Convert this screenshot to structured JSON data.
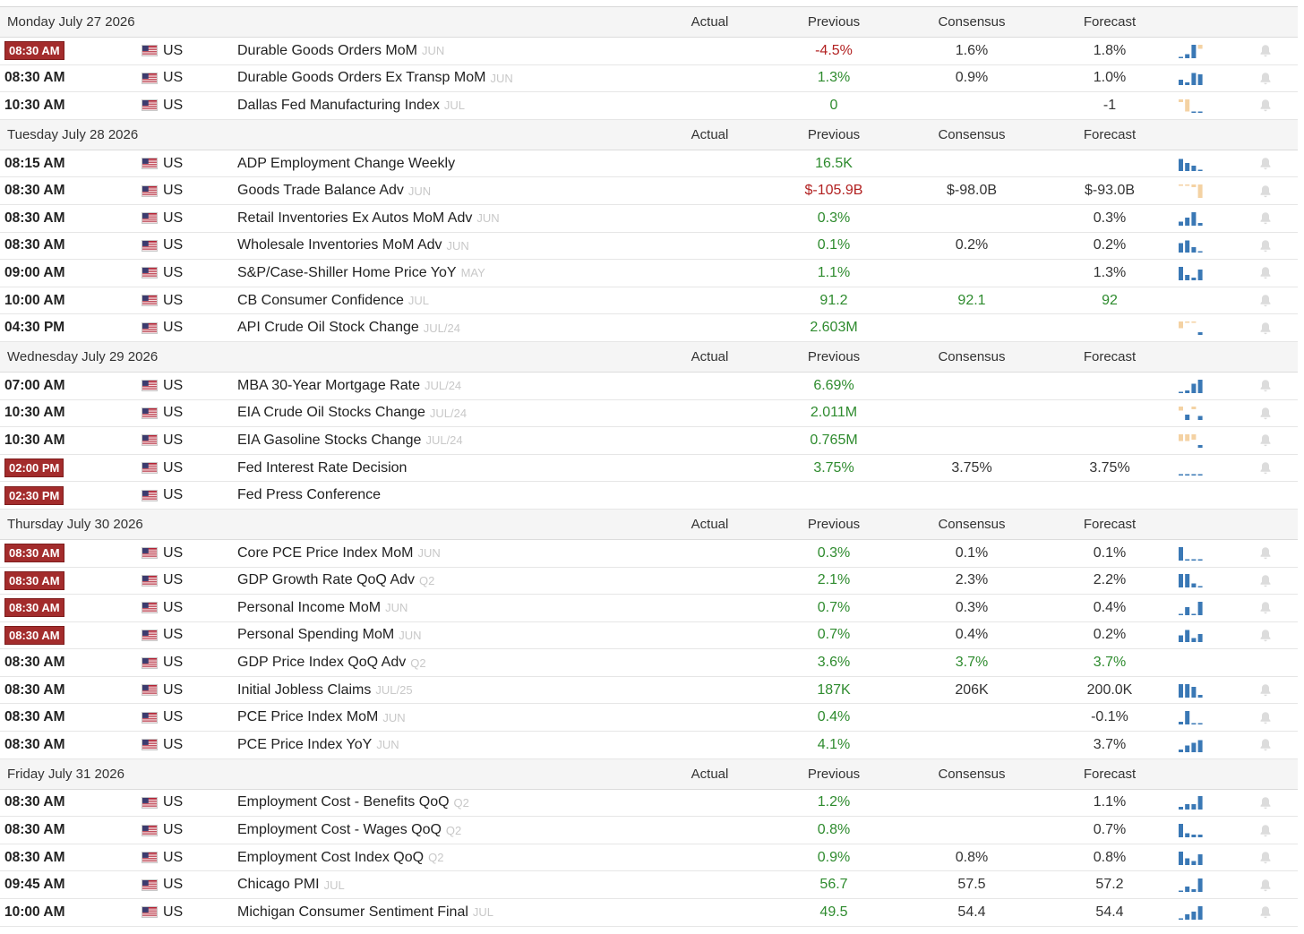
{
  "columns": {
    "actual": "Actual",
    "previous": "Previous",
    "consensus": "Consensus",
    "forecast": "Forecast"
  },
  "colors": {
    "badge": "#a32c2c",
    "negative": "#b22121",
    "positive": "#2e8b2e",
    "spark_up": "#3a78b5",
    "spark_down": "#f4d2a3"
  },
  "days": [
    {
      "date": "Monday July 27 2026",
      "events": [
        {
          "time": "08:30 AM",
          "highlight": true,
          "country": "US",
          "name": "Durable Goods Orders MoM",
          "period": "JUN",
          "actual": "",
          "previous": "-4.5%",
          "previous_color": "red",
          "consensus": "1.6%",
          "consensus_color": "neutral",
          "forecast": "1.8%",
          "forecast_color": "neutral",
          "spark": [
            1,
            3,
            10,
            -3
          ],
          "bell": true
        },
        {
          "time": "08:30 AM",
          "highlight": false,
          "country": "US",
          "name": "Durable Goods Orders Ex Transp MoM",
          "period": "JUN",
          "actual": "",
          "previous": "1.3%",
          "previous_color": "green",
          "consensus": "0.9%",
          "consensus_color": "neutral",
          "forecast": "1.0%",
          "forecast_color": "neutral",
          "spark": [
            4,
            2,
            9,
            8
          ],
          "bell": true
        },
        {
          "time": "10:30 AM",
          "highlight": false,
          "country": "US",
          "name": "Dallas Fed Manufacturing Index",
          "period": "JUL",
          "actual": "",
          "previous": "0",
          "previous_color": "green",
          "consensus": "",
          "consensus_color": "neutral",
          "forecast": "-1",
          "forecast_color": "neutral",
          "spark": [
            -2,
            -9,
            0,
            1
          ],
          "bell": true
        }
      ]
    },
    {
      "date": "Tuesday July 28 2026",
      "events": [
        {
          "time": "08:15 AM",
          "highlight": false,
          "country": "US",
          "name": "ADP Employment Change Weekly",
          "period": "",
          "actual": "",
          "previous": "16.5K",
          "previous_color": "green",
          "consensus": "",
          "consensus_color": "neutral",
          "forecast": "",
          "forecast_color": "neutral",
          "spark": [
            9,
            6,
            4,
            1
          ],
          "bell": true
        },
        {
          "time": "08:30 AM",
          "highlight": false,
          "country": "US",
          "name": "Goods Trade Balance Adv",
          "period": "JUN",
          "actual": "",
          "previous": "$-105.9B",
          "previous_color": "red",
          "consensus": "$-98.0B",
          "consensus_color": "neutral",
          "forecast": "$-93.0B",
          "forecast_color": "neutral",
          "spark": [
            -1,
            -1,
            -2,
            -10
          ],
          "bell": true
        },
        {
          "time": "08:30 AM",
          "highlight": false,
          "country": "US",
          "name": "Retail Inventories Ex Autos MoM Adv",
          "period": "JUN",
          "actual": "",
          "previous": "0.3%",
          "previous_color": "green",
          "consensus": "",
          "consensus_color": "neutral",
          "forecast": "0.3%",
          "forecast_color": "neutral",
          "spark": [
            3,
            6,
            10,
            2
          ],
          "bell": true
        },
        {
          "time": "08:30 AM",
          "highlight": false,
          "country": "US",
          "name": "Wholesale Inventories MoM Adv",
          "period": "JUN",
          "actual": "",
          "previous": "0.1%",
          "previous_color": "green",
          "consensus": "0.2%",
          "consensus_color": "neutral",
          "forecast": "0.2%",
          "forecast_color": "neutral",
          "spark": [
            7,
            9,
            4,
            1
          ],
          "bell": true
        },
        {
          "time": "09:00 AM",
          "highlight": false,
          "country": "US",
          "name": "S&P/Case-Shiller Home Price YoY",
          "period": "MAY",
          "actual": "",
          "previous": "1.1%",
          "previous_color": "green",
          "consensus": "",
          "consensus_color": "neutral",
          "forecast": "1.3%",
          "forecast_color": "neutral",
          "spark": [
            10,
            4,
            2,
            8
          ],
          "bell": true
        },
        {
          "time": "10:00 AM",
          "highlight": false,
          "country": "US",
          "name": "CB Consumer Confidence",
          "period": "JUL",
          "actual": "",
          "previous": "91.2",
          "previous_color": "green",
          "consensus": "92.1",
          "consensus_color": "green",
          "forecast": "92",
          "forecast_color": "green",
          "spark": [],
          "bell": true
        },
        {
          "time": "04:30 PM",
          "highlight": false,
          "country": "US",
          "name": "API Crude Oil Stock Change",
          "period": "JUL/24",
          "actual": "",
          "previous": "2.603M",
          "previous_color": "green",
          "consensus": "",
          "consensus_color": "neutral",
          "forecast": "",
          "forecast_color": "neutral",
          "spark": [
            -5,
            -1,
            -1,
            2
          ],
          "bell": true
        }
      ]
    },
    {
      "date": "Wednesday July 29 2026",
      "events": [
        {
          "time": "07:00 AM",
          "highlight": false,
          "country": "US",
          "name": "MBA 30-Year Mortgage Rate",
          "period": "JUL/24",
          "actual": "",
          "previous": "6.69%",
          "previous_color": "green",
          "consensus": "",
          "consensus_color": "neutral",
          "forecast": "",
          "forecast_color": "neutral",
          "spark": [
            1,
            2,
            7,
            10
          ],
          "bell": true
        },
        {
          "time": "10:30 AM",
          "highlight": false,
          "country": "US",
          "name": "EIA Crude Oil Stocks Change",
          "period": "JUL/24",
          "actual": "",
          "previous": "2.011M",
          "previous_color": "green",
          "consensus": "",
          "consensus_color": "neutral",
          "forecast": "",
          "forecast_color": "neutral",
          "spark": [
            -3,
            4,
            -2,
            3
          ],
          "bell": true
        },
        {
          "time": "10:30 AM",
          "highlight": false,
          "country": "US",
          "name": "EIA Gasoline Stocks Change",
          "period": "JUL/24",
          "actual": "",
          "previous": "0.765M",
          "previous_color": "green",
          "consensus": "",
          "consensus_color": "neutral",
          "forecast": "",
          "forecast_color": "neutral",
          "spark": [
            -5,
            -5,
            -4,
            2
          ],
          "bell": true
        },
        {
          "time": "02:00 PM",
          "highlight": true,
          "country": "US",
          "name": "Fed Interest Rate Decision",
          "period": "",
          "actual": "",
          "previous": "3.75%",
          "previous_color": "green",
          "consensus": "3.75%",
          "consensus_color": "neutral",
          "forecast": "3.75%",
          "forecast_color": "neutral",
          "spark": [
            1,
            1,
            1,
            1
          ],
          "bell": true
        },
        {
          "time": "02:30 PM",
          "highlight": true,
          "country": "US",
          "name": "Fed Press Conference",
          "period": "",
          "actual": "",
          "previous": "",
          "previous_color": "neutral",
          "consensus": "",
          "consensus_color": "neutral",
          "forecast": "",
          "forecast_color": "neutral",
          "spark": [],
          "bell": false
        }
      ]
    },
    {
      "date": "Thursday July 30 2026",
      "events": [
        {
          "time": "08:30 AM",
          "highlight": true,
          "country": "US",
          "name": "Core PCE Price Index MoM",
          "period": "JUN",
          "actual": "",
          "previous": "0.3%",
          "previous_color": "green",
          "consensus": "0.1%",
          "consensus_color": "neutral",
          "forecast": "0.1%",
          "forecast_color": "neutral",
          "spark": [
            10,
            1,
            1,
            1
          ],
          "bell": true
        },
        {
          "time": "08:30 AM",
          "highlight": true,
          "country": "US",
          "name": "GDP Growth Rate QoQ Adv",
          "period": "Q2",
          "actual": "",
          "previous": "2.1%",
          "previous_color": "green",
          "consensus": "2.3%",
          "consensus_color": "neutral",
          "forecast": "2.2%",
          "forecast_color": "neutral",
          "spark": [
            10,
            10,
            3,
            1
          ],
          "bell": true
        },
        {
          "time": "08:30 AM",
          "highlight": true,
          "country": "US",
          "name": "Personal Income MoM",
          "period": "JUN",
          "actual": "",
          "previous": "0.7%",
          "previous_color": "green",
          "consensus": "0.3%",
          "consensus_color": "neutral",
          "forecast": "0.4%",
          "forecast_color": "neutral",
          "spark": [
            0,
            6,
            0,
            10
          ],
          "bell": true
        },
        {
          "time": "08:30 AM",
          "highlight": true,
          "country": "US",
          "name": "Personal Spending MoM",
          "period": "JUN",
          "actual": "",
          "previous": "0.7%",
          "previous_color": "green",
          "consensus": "0.4%",
          "consensus_color": "neutral",
          "forecast": "0.2%",
          "forecast_color": "neutral",
          "spark": [
            5,
            9,
            3,
            6
          ],
          "bell": true
        },
        {
          "time": "08:30 AM",
          "highlight": false,
          "country": "US",
          "name": "GDP Price Index QoQ Adv",
          "period": "Q2",
          "actual": "",
          "previous": "3.6%",
          "previous_color": "green",
          "consensus": "3.7%",
          "consensus_color": "green",
          "forecast": "3.7%",
          "forecast_color": "green",
          "spark": [],
          "bell": false
        },
        {
          "time": "08:30 AM",
          "highlight": false,
          "country": "US",
          "name": "Initial Jobless Claims",
          "period": "JUL/25",
          "actual": "",
          "previous": "187K",
          "previous_color": "green",
          "consensus": "206K",
          "consensus_color": "neutral",
          "forecast": "200.0K",
          "forecast_color": "neutral",
          "spark": [
            10,
            10,
            8,
            2
          ],
          "bell": true
        },
        {
          "time": "08:30 AM",
          "highlight": false,
          "country": "US",
          "name": "PCE Price Index MoM",
          "period": "JUN",
          "actual": "",
          "previous": "0.4%",
          "previous_color": "green",
          "consensus": "",
          "consensus_color": "neutral",
          "forecast": "-0.1%",
          "forecast_color": "neutral",
          "spark": [
            2,
            10,
            1,
            1
          ],
          "bell": true
        },
        {
          "time": "08:30 AM",
          "highlight": false,
          "country": "US",
          "name": "PCE Price Index YoY",
          "period": "JUN",
          "actual": "",
          "previous": "4.1%",
          "previous_color": "green",
          "consensus": "",
          "consensus_color": "neutral",
          "forecast": "3.7%",
          "forecast_color": "neutral",
          "spark": [
            2,
            5,
            7,
            9
          ],
          "bell": true
        }
      ]
    },
    {
      "date": "Friday July 31 2026",
      "events": [
        {
          "time": "08:30 AM",
          "highlight": false,
          "country": "US",
          "name": "Employment Cost - Benefits QoQ",
          "period": "Q2",
          "actual": "",
          "previous": "1.2%",
          "previous_color": "green",
          "consensus": "",
          "consensus_color": "neutral",
          "forecast": "1.1%",
          "forecast_color": "neutral",
          "spark": [
            2,
            4,
            4,
            10
          ],
          "bell": true
        },
        {
          "time": "08:30 AM",
          "highlight": false,
          "country": "US",
          "name": "Employment Cost - Wages QoQ",
          "period": "Q2",
          "actual": "",
          "previous": "0.8%",
          "previous_color": "green",
          "consensus": "",
          "consensus_color": "neutral",
          "forecast": "0.7%",
          "forecast_color": "neutral",
          "spark": [
            10,
            3,
            2,
            2
          ],
          "bell": true
        },
        {
          "time": "08:30 AM",
          "highlight": false,
          "country": "US",
          "name": "Employment Cost Index QoQ",
          "period": "Q2",
          "actual": "",
          "previous": "0.9%",
          "previous_color": "green",
          "consensus": "0.8%",
          "consensus_color": "neutral",
          "forecast": "0.8%",
          "forecast_color": "neutral",
          "spark": [
            10,
            5,
            3,
            8
          ],
          "bell": true
        },
        {
          "time": "09:45 AM",
          "highlight": false,
          "country": "US",
          "name": "Chicago PMI",
          "period": "JUL",
          "actual": "",
          "previous": "56.7",
          "previous_color": "green",
          "consensus": "57.5",
          "consensus_color": "neutral",
          "forecast": "57.2",
          "forecast_color": "neutral",
          "spark": [
            1,
            4,
            2,
            10
          ],
          "bell": true
        },
        {
          "time": "10:00 AM",
          "highlight": false,
          "country": "US",
          "name": "Michigan Consumer Sentiment Final",
          "period": "JUL",
          "actual": "",
          "previous": "49.5",
          "previous_color": "green",
          "consensus": "54.4",
          "consensus_color": "neutral",
          "forecast": "54.4",
          "forecast_color": "neutral",
          "spark": [
            1,
            4,
            6,
            10
          ],
          "bell": true
        }
      ]
    }
  ]
}
